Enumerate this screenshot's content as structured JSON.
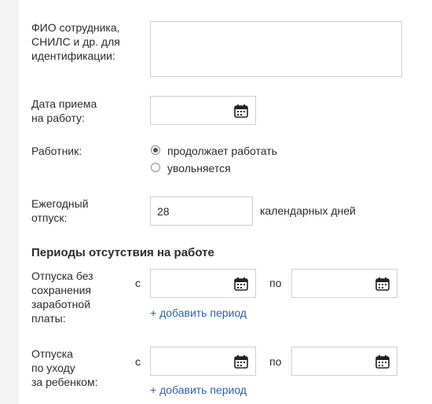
{
  "employee_id": {
    "label": "ФИО сотрудника, СНИЛС и др. для идентификации:",
    "value": ""
  },
  "hire_date": {
    "label_line1": "Дата приема",
    "label_line2": "на работу:",
    "value": ""
  },
  "worker": {
    "label": "Работник:",
    "options": [
      {
        "label": "продолжает работать",
        "checked": true
      },
      {
        "label": "увольняется",
        "checked": false
      }
    ]
  },
  "vacation": {
    "label_line1": "Ежегодный",
    "label_line2": "отпуск:",
    "value": "28",
    "unit": "календарных дней"
  },
  "absence": {
    "title": "Периоды отсутствия на работе",
    "unpaid": {
      "label_lines": [
        "Отпуска без",
        "сохранения",
        "заработной",
        "платы:"
      ],
      "from_label": "с",
      "to_label": "по",
      "add_link": "+ добавить период"
    },
    "childcare": {
      "label_lines": [
        "Отпуска",
        "по уходу",
        "за ребенком:"
      ],
      "from_label": "с",
      "to_label": "по",
      "add_link": "+ добавить период"
    }
  }
}
